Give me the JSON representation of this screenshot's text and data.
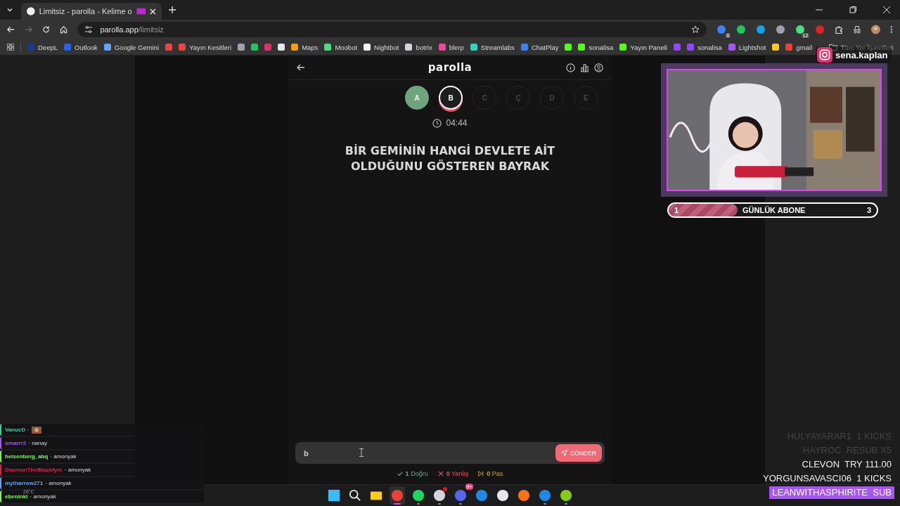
{
  "browser": {
    "tab_title": "Limitsiz - parolla - Kelime o",
    "url_host": "parolla.app",
    "url_path": "/limitsiz",
    "extensions": [
      {
        "color": "#3b82f6",
        "badge": "6"
      },
      {
        "color": "#22c55e"
      },
      {
        "color": "#0ea5e9"
      },
      {
        "color": "#9ca3af"
      },
      {
        "color": "#4ade80",
        "badge": "12"
      },
      {
        "color": "#dc2626"
      }
    ],
    "bookmarks": [
      {
        "label": "DeepL",
        "color": "#1e3a8a"
      },
      {
        "label": "Outlook",
        "color": "#2563eb"
      },
      {
        "label": "Google Gemini",
        "color": "#60a5fa"
      },
      {
        "color": "#ef4444"
      },
      {
        "label": "Yayın Kesitleri",
        "color": "#ef4444"
      },
      {
        "color": "#9ca3af"
      },
      {
        "color": "#22c55e"
      },
      {
        "color": "#e1306c"
      },
      {
        "color": "#e5e7eb"
      },
      {
        "label": "Maps",
        "color": "#f59e0b"
      },
      {
        "label": "Moobot",
        "color": "#4ade80"
      },
      {
        "label": "Nightbot",
        "color": "#f3f4f6"
      },
      {
        "label": "botrix",
        "color": "#d1d5db"
      },
      {
        "label": "blerp",
        "color": "#ec4899"
      },
      {
        "label": "Streamlabs",
        "color": "#2dd4bf"
      },
      {
        "label": "ChatPlay",
        "color": "#3b82f6"
      },
      {
        "color": "#53fc18"
      },
      {
        "label": "sonalisa",
        "color": "#53fc18"
      },
      {
        "label": "Yayın Paneli",
        "color": "#53fc18"
      },
      {
        "color": "#9146ff"
      },
      {
        "label": "sonalisa",
        "color": "#9146ff"
      },
      {
        "label": "Lightshot",
        "color": "#a855f7"
      },
      {
        "color": "#facc15"
      },
      {
        "label": "gmail",
        "color": "#ea4335"
      }
    ],
    "all_bookmarks": "Tüm Yer İşaretleri"
  },
  "game": {
    "title": "parolla",
    "letters": [
      {
        "letter": "A",
        "correct": true,
        "selected": false
      },
      {
        "letter": "B",
        "correct": false,
        "selected": true
      },
      {
        "letter": "C",
        "correct": false,
        "selected": false
      },
      {
        "letter": "Ç",
        "correct": false,
        "selected": false
      },
      {
        "letter": "D",
        "correct": false,
        "selected": false
      },
      {
        "letter": "E",
        "correct": false,
        "selected": false
      }
    ],
    "timer": "04:44",
    "question": "BİR GEMİNİN HANGİ DEVLETE AİT OLDUĞUNU GÖSTEREN BAYRAK",
    "answer": "b",
    "submit": "GÖNDER",
    "stats": [
      {
        "kind": "correct",
        "count": "1",
        "label": "Doğru"
      },
      {
        "kind": "wrong",
        "count": "0",
        "label": "Yanlış"
      },
      {
        "kind": "pass",
        "count": "0",
        "label": "Pas"
      }
    ]
  },
  "stream": {
    "instagram": "sena.kaplan",
    "goal": {
      "current": "1",
      "title": "GÜNLÜK ABONE",
      "target": "3",
      "level": 0.33
    },
    "chat": [
      {
        "user": "VanucD",
        "color": "#2dd4a0",
        "text": "·",
        "emote": true
      },
      {
        "user": "omarrr2",
        "color": "#a855f7",
        "text": "· nanay"
      },
      {
        "user": "heisenberg_abq",
        "color": "#7cfc4a",
        "text": "· amonyak"
      },
      {
        "user": "DaemonTheBlackfyre",
        "color": "#e11d48",
        "text": "· amonyak"
      },
      {
        "user": "mytharrow271",
        "color": "#60a5fa",
        "text": "· amonyak"
      },
      {
        "user": "ebeninki",
        "color": "#7cfc4a",
        "text": "· amonyak"
      }
    ],
    "weather": "26°C",
    "events": [
      {
        "kind": "faded",
        "name": "HULYAYARAR1",
        "detail": "1 KICKS"
      },
      {
        "kind": "faded",
        "name": "HAYROC",
        "detail": "RESUB X5"
      },
      {
        "kind": "normal",
        "name": "CLEVON",
        "detail": "TRY 111.00"
      },
      {
        "kind": "normal",
        "name": "YORGUNSAVASCI06",
        "detail": "1 KICKS"
      },
      {
        "kind": "highlight",
        "name": "LEANWITHASPHIRITE",
        "detail": "SUB"
      }
    ]
  },
  "taskbar": [
    {
      "kind": "windows",
      "running": false,
      "active": false
    },
    {
      "kind": "search",
      "running": false,
      "active": false
    },
    {
      "kind": "folder",
      "running": false,
      "active": false
    },
    {
      "kind": "chrome",
      "running": true,
      "active": true
    },
    {
      "kind": "spotify",
      "running": true,
      "active": false
    },
    {
      "kind": "obs",
      "running": true,
      "active": false,
      "dot": true
    },
    {
      "kind": "discord",
      "running": true,
      "active": false,
      "badge": "9+"
    },
    {
      "kind": "steam",
      "running": false,
      "active": false
    },
    {
      "kind": "crest",
      "running": false,
      "active": false
    },
    {
      "kind": "burst",
      "running": false,
      "active": false
    },
    {
      "kind": "steam",
      "running": true,
      "active": false
    },
    {
      "kind": "play",
      "running": true,
      "active": false
    }
  ]
}
